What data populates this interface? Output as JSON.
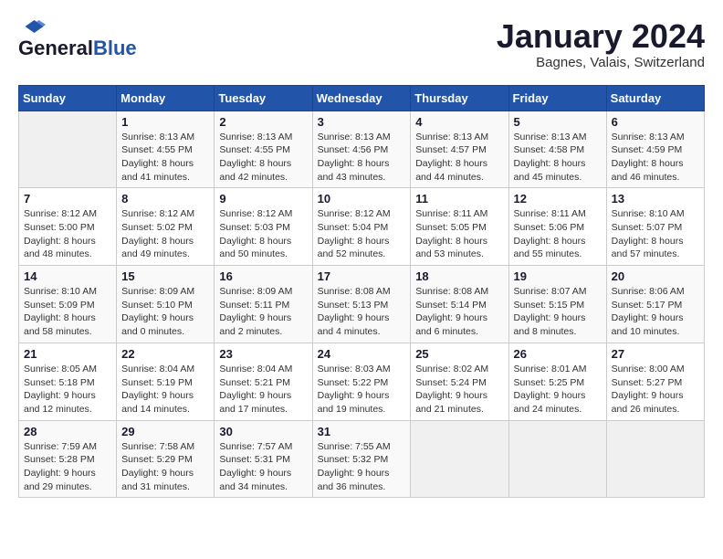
{
  "header": {
    "logo_general": "General",
    "logo_blue": "Blue",
    "month_title": "January 2024",
    "location": "Bagnes, Valais, Switzerland"
  },
  "weekdays": [
    "Sunday",
    "Monday",
    "Tuesday",
    "Wednesday",
    "Thursday",
    "Friday",
    "Saturday"
  ],
  "weeks": [
    [
      {
        "day": "",
        "sunrise": "",
        "sunset": "",
        "daylight": ""
      },
      {
        "day": "1",
        "sunrise": "Sunrise: 8:13 AM",
        "sunset": "Sunset: 4:55 PM",
        "daylight": "Daylight: 8 hours and 41 minutes."
      },
      {
        "day": "2",
        "sunrise": "Sunrise: 8:13 AM",
        "sunset": "Sunset: 4:55 PM",
        "daylight": "Daylight: 8 hours and 42 minutes."
      },
      {
        "day": "3",
        "sunrise": "Sunrise: 8:13 AM",
        "sunset": "Sunset: 4:56 PM",
        "daylight": "Daylight: 8 hours and 43 minutes."
      },
      {
        "day": "4",
        "sunrise": "Sunrise: 8:13 AM",
        "sunset": "Sunset: 4:57 PM",
        "daylight": "Daylight: 8 hours and 44 minutes."
      },
      {
        "day": "5",
        "sunrise": "Sunrise: 8:13 AM",
        "sunset": "Sunset: 4:58 PM",
        "daylight": "Daylight: 8 hours and 45 minutes."
      },
      {
        "day": "6",
        "sunrise": "Sunrise: 8:13 AM",
        "sunset": "Sunset: 4:59 PM",
        "daylight": "Daylight: 8 hours and 46 minutes."
      }
    ],
    [
      {
        "day": "7",
        "sunrise": "Sunrise: 8:12 AM",
        "sunset": "Sunset: 5:00 PM",
        "daylight": "Daylight: 8 hours and 48 minutes."
      },
      {
        "day": "8",
        "sunrise": "Sunrise: 8:12 AM",
        "sunset": "Sunset: 5:02 PM",
        "daylight": "Daylight: 8 hours and 49 minutes."
      },
      {
        "day": "9",
        "sunrise": "Sunrise: 8:12 AM",
        "sunset": "Sunset: 5:03 PM",
        "daylight": "Daylight: 8 hours and 50 minutes."
      },
      {
        "day": "10",
        "sunrise": "Sunrise: 8:12 AM",
        "sunset": "Sunset: 5:04 PM",
        "daylight": "Daylight: 8 hours and 52 minutes."
      },
      {
        "day": "11",
        "sunrise": "Sunrise: 8:11 AM",
        "sunset": "Sunset: 5:05 PM",
        "daylight": "Daylight: 8 hours and 53 minutes."
      },
      {
        "day": "12",
        "sunrise": "Sunrise: 8:11 AM",
        "sunset": "Sunset: 5:06 PM",
        "daylight": "Daylight: 8 hours and 55 minutes."
      },
      {
        "day": "13",
        "sunrise": "Sunrise: 8:10 AM",
        "sunset": "Sunset: 5:07 PM",
        "daylight": "Daylight: 8 hours and 57 minutes."
      }
    ],
    [
      {
        "day": "14",
        "sunrise": "Sunrise: 8:10 AM",
        "sunset": "Sunset: 5:09 PM",
        "daylight": "Daylight: 8 hours and 58 minutes."
      },
      {
        "day": "15",
        "sunrise": "Sunrise: 8:09 AM",
        "sunset": "Sunset: 5:10 PM",
        "daylight": "Daylight: 9 hours and 0 minutes."
      },
      {
        "day": "16",
        "sunrise": "Sunrise: 8:09 AM",
        "sunset": "Sunset: 5:11 PM",
        "daylight": "Daylight: 9 hours and 2 minutes."
      },
      {
        "day": "17",
        "sunrise": "Sunrise: 8:08 AM",
        "sunset": "Sunset: 5:13 PM",
        "daylight": "Daylight: 9 hours and 4 minutes."
      },
      {
        "day": "18",
        "sunrise": "Sunrise: 8:08 AM",
        "sunset": "Sunset: 5:14 PM",
        "daylight": "Daylight: 9 hours and 6 minutes."
      },
      {
        "day": "19",
        "sunrise": "Sunrise: 8:07 AM",
        "sunset": "Sunset: 5:15 PM",
        "daylight": "Daylight: 9 hours and 8 minutes."
      },
      {
        "day": "20",
        "sunrise": "Sunrise: 8:06 AM",
        "sunset": "Sunset: 5:17 PM",
        "daylight": "Daylight: 9 hours and 10 minutes."
      }
    ],
    [
      {
        "day": "21",
        "sunrise": "Sunrise: 8:05 AM",
        "sunset": "Sunset: 5:18 PM",
        "daylight": "Daylight: 9 hours and 12 minutes."
      },
      {
        "day": "22",
        "sunrise": "Sunrise: 8:04 AM",
        "sunset": "Sunset: 5:19 PM",
        "daylight": "Daylight: 9 hours and 14 minutes."
      },
      {
        "day": "23",
        "sunrise": "Sunrise: 8:04 AM",
        "sunset": "Sunset: 5:21 PM",
        "daylight": "Daylight: 9 hours and 17 minutes."
      },
      {
        "day": "24",
        "sunrise": "Sunrise: 8:03 AM",
        "sunset": "Sunset: 5:22 PM",
        "daylight": "Daylight: 9 hours and 19 minutes."
      },
      {
        "day": "25",
        "sunrise": "Sunrise: 8:02 AM",
        "sunset": "Sunset: 5:24 PM",
        "daylight": "Daylight: 9 hours and 21 minutes."
      },
      {
        "day": "26",
        "sunrise": "Sunrise: 8:01 AM",
        "sunset": "Sunset: 5:25 PM",
        "daylight": "Daylight: 9 hours and 24 minutes."
      },
      {
        "day": "27",
        "sunrise": "Sunrise: 8:00 AM",
        "sunset": "Sunset: 5:27 PM",
        "daylight": "Daylight: 9 hours and 26 minutes."
      }
    ],
    [
      {
        "day": "28",
        "sunrise": "Sunrise: 7:59 AM",
        "sunset": "Sunset: 5:28 PM",
        "daylight": "Daylight: 9 hours and 29 minutes."
      },
      {
        "day": "29",
        "sunrise": "Sunrise: 7:58 AM",
        "sunset": "Sunset: 5:29 PM",
        "daylight": "Daylight: 9 hours and 31 minutes."
      },
      {
        "day": "30",
        "sunrise": "Sunrise: 7:57 AM",
        "sunset": "Sunset: 5:31 PM",
        "daylight": "Daylight: 9 hours and 34 minutes."
      },
      {
        "day": "31",
        "sunrise": "Sunrise: 7:55 AM",
        "sunset": "Sunset: 5:32 PM",
        "daylight": "Daylight: 9 hours and 36 minutes."
      },
      {
        "day": "",
        "sunrise": "",
        "sunset": "",
        "daylight": ""
      },
      {
        "day": "",
        "sunrise": "",
        "sunset": "",
        "daylight": ""
      },
      {
        "day": "",
        "sunrise": "",
        "sunset": "",
        "daylight": ""
      }
    ]
  ]
}
